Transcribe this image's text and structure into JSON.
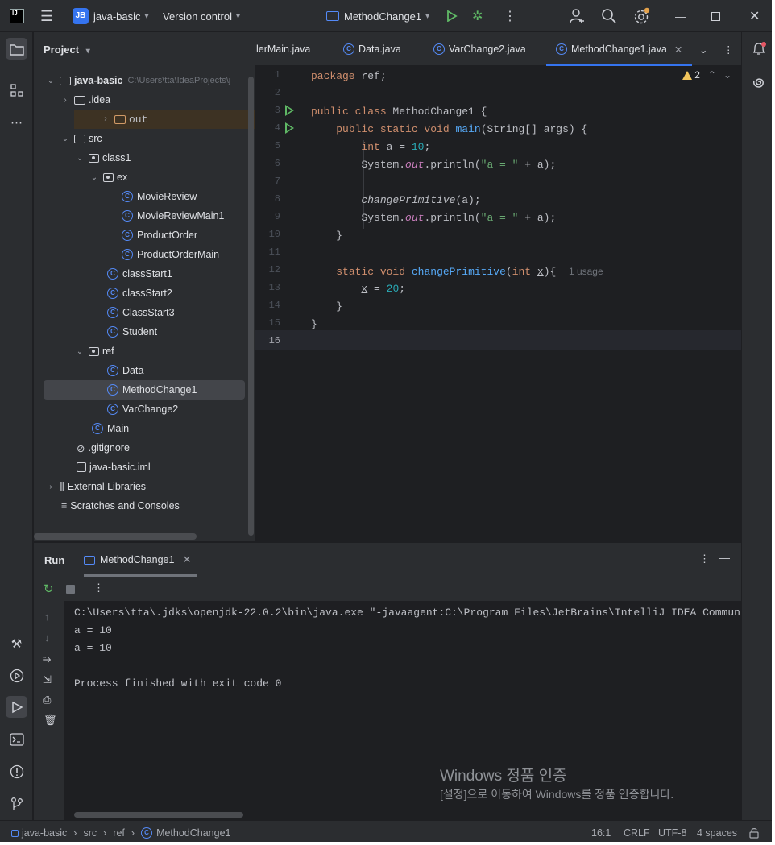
{
  "titlebar": {
    "project_badge": "JB",
    "project_name": "java-basic",
    "vcs": "Version control",
    "run_config": "MethodChange1"
  },
  "project_panel": {
    "title": "Project",
    "tree": [
      {
        "label": "java-basic",
        "hint": "C:\\Users\\tta\\IdeaProjects\\j",
        "type": "root"
      },
      {
        "label": ".idea",
        "type": "folder"
      },
      {
        "label": "out",
        "type": "folder-excluded"
      },
      {
        "label": "src",
        "type": "folder"
      },
      {
        "label": "class1",
        "type": "package"
      },
      {
        "label": "ex",
        "type": "package"
      },
      {
        "label": "MovieReview",
        "type": "class"
      },
      {
        "label": "MovieReviewMain1",
        "type": "main-class"
      },
      {
        "label": "ProductOrder",
        "type": "class"
      },
      {
        "label": "ProductOrderMain",
        "type": "main-class"
      },
      {
        "label": "classStart1",
        "type": "main-class"
      },
      {
        "label": "classStart2",
        "type": "main-class"
      },
      {
        "label": "ClassStart3",
        "type": "main-class"
      },
      {
        "label": "Student",
        "type": "class"
      },
      {
        "label": "ref",
        "type": "package"
      },
      {
        "label": "Data",
        "type": "class"
      },
      {
        "label": "MethodChange1",
        "type": "main-class",
        "selected": true
      },
      {
        "label": "VarChange2",
        "type": "main-class"
      },
      {
        "label": "Main",
        "type": "main-class"
      },
      {
        "label": ".gitignore",
        "type": "ignore"
      },
      {
        "label": "java-basic.iml",
        "type": "iml"
      },
      {
        "label": "External Libraries",
        "type": "library"
      },
      {
        "label": "Scratches and Consoles",
        "type": "scratch"
      }
    ]
  },
  "editor": {
    "tabs": [
      {
        "label": "lerMain.java"
      },
      {
        "label": "Data.java"
      },
      {
        "label": "VarChange2.java"
      },
      {
        "label": "MethodChange1.java",
        "active": true
      }
    ],
    "warnings": "2",
    "line_numbers": [
      "1",
      "2",
      "3",
      "4",
      "5",
      "6",
      "7",
      "8",
      "9",
      "10",
      "11",
      "12",
      "13",
      "14",
      "15",
      "16"
    ],
    "usage_hint": "1 usage"
  },
  "run_panel": {
    "title": "Run",
    "tab": "MethodChange1",
    "output": [
      "C:\\Users\\tta\\.jdks\\openjdk-22.0.2\\bin\\java.exe \"-javaagent:C:\\Program Files\\JetBrains\\IntelliJ IDEA Community Edition",
      "a = 10",
      "a = 10",
      "",
      "Process finished with exit code 0"
    ]
  },
  "watermark": {
    "line1": "Windows 정품 인증",
    "line2": "[설정]으로 이동하여 Windows를 정품 인증합니다."
  },
  "statusbar": {
    "breadcrumbs": [
      "java-basic",
      "src",
      "ref",
      "MethodChange1"
    ],
    "position": "16:1",
    "line_sep": "CRLF",
    "encoding": "UTF-8",
    "indent": "4 spaces"
  }
}
